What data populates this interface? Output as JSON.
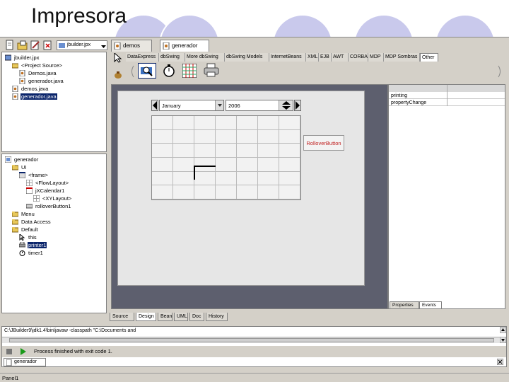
{
  "slide": {
    "title": "Impresora"
  },
  "toolbar": {
    "project_combo": "jbuilder.jpx"
  },
  "doc_tabs": [
    {
      "label": "demos",
      "active": false
    },
    {
      "label": "generador",
      "active": true
    }
  ],
  "project_tree": [
    {
      "label": "jbuilder.jpx",
      "indent": 0,
      "icon": "project-icon"
    },
    {
      "label": "<Project Source>",
      "indent": 1,
      "icon": "package-icon"
    },
    {
      "label": "Demos.java",
      "indent": 2,
      "icon": "java-file-icon"
    },
    {
      "label": "generador.java",
      "indent": 2,
      "icon": "java-file-icon"
    },
    {
      "label": "demos.java",
      "indent": 1,
      "icon": "java-file-icon"
    },
    {
      "label": "generador.java",
      "indent": 1,
      "icon": "java-file-icon",
      "selected": true
    }
  ],
  "structure_tree": [
    {
      "label": "generador",
      "indent": 0,
      "icon": "class-icon"
    },
    {
      "label": "UI",
      "indent": 1,
      "icon": "folder-icon"
    },
    {
      "label": "<frame>",
      "indent": 2,
      "icon": "frame-icon"
    },
    {
      "label": "<FlowLayout>",
      "indent": 3,
      "icon": "layout-icon"
    },
    {
      "label": "jXCalendar1",
      "indent": 3,
      "icon": "calendar-icon"
    },
    {
      "label": "<XYLayout>",
      "indent": 4,
      "icon": "layout-icon"
    },
    {
      "label": "rolloverButton1",
      "indent": 3,
      "icon": "button-icon"
    },
    {
      "label": "Menu",
      "indent": 1,
      "icon": "folder-icon"
    },
    {
      "label": "Data Access",
      "indent": 1,
      "icon": "folder-icon"
    },
    {
      "label": "Default",
      "indent": 1,
      "icon": "folder-icon"
    },
    {
      "label": "this",
      "indent": 2,
      "icon": "pointer-icon"
    },
    {
      "label": "printer1",
      "indent": 2,
      "icon": "printer-icon",
      "selected": true
    },
    {
      "label": "timer1",
      "indent": 2,
      "icon": "timer-icon"
    }
  ],
  "palette_tabs": [
    {
      "label": "DataExpress",
      "active": false
    },
    {
      "label": "dbSwing",
      "active": false
    },
    {
      "label": "More dbSwing",
      "active": false
    },
    {
      "label": "dbSwing Models",
      "active": false
    },
    {
      "label": "InternetBeans",
      "active": false
    },
    {
      "label": "XML",
      "active": false
    },
    {
      "label": "EJB",
      "active": false
    },
    {
      "label": "AWT",
      "active": false
    },
    {
      "label": "CORBA",
      "active": false
    },
    {
      "label": "MDP",
      "active": false
    },
    {
      "label": "MDP Sombras",
      "active": false
    },
    {
      "label": "Other",
      "active": true
    }
  ],
  "palette_icons": [
    "search-icon",
    "stopwatch-icon",
    "grid-icon",
    "printer-icon"
  ],
  "calendar": {
    "month": "January",
    "year": "2006",
    "rows": 6,
    "cols": 7
  },
  "rollover_button": {
    "label": "RolloverButton"
  },
  "properties": [
    {
      "name": "printing",
      "value": ""
    },
    {
      "name": "propertyChange",
      "value": ""
    }
  ],
  "property_tabs": [
    {
      "label": "Properties",
      "active": false
    },
    {
      "label": "Events",
      "active": true
    }
  ],
  "bottom_tabs": [
    {
      "label": "Source",
      "active": false
    },
    {
      "label": "Design",
      "active": true
    },
    {
      "label": "Bean",
      "active": false
    },
    {
      "label": "UML",
      "active": false
    },
    {
      "label": "Doc",
      "active": false
    },
    {
      "label": "History",
      "active": false
    }
  ],
  "command_line": "C:\\JBuilder9\\jdk1.4\\bin\\javaw -classpath \"C:\\Documents and",
  "process_status": "Process finished with exit code 1.",
  "message_tab": "generador",
  "status_bar": "Panel1"
}
